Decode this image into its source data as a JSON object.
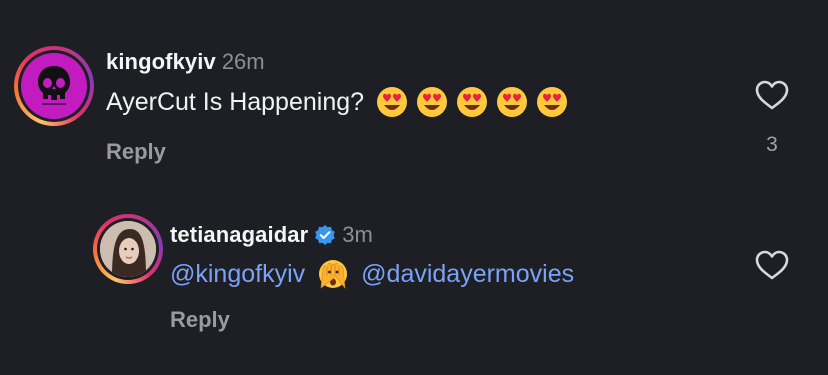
{
  "comments": [
    {
      "username": "kingofkyiv",
      "time": "26m",
      "text": "AyerCut Is Happening?",
      "emojis": [
        "heart-eyes",
        "heart-eyes",
        "heart-eyes",
        "heart-eyes",
        "heart-eyes"
      ],
      "reply_label": "Reply",
      "like_count": "3",
      "avatar_icon": "skull-icon",
      "avatar_color": "#c21cc0"
    },
    {
      "username": "tetianagaidar",
      "verified": true,
      "time": "3m",
      "mention_1": "@kingofkyiv",
      "emoji": "face-peeking",
      "mention_2": "@davidayermovies",
      "reply_label": "Reply",
      "avatar_icon": "profile-photo"
    }
  ],
  "colors": {
    "background": "#1e1f24",
    "mention": "#7aa2f7",
    "secondary_text": "#8e8e93",
    "verified": "#3897f0"
  }
}
